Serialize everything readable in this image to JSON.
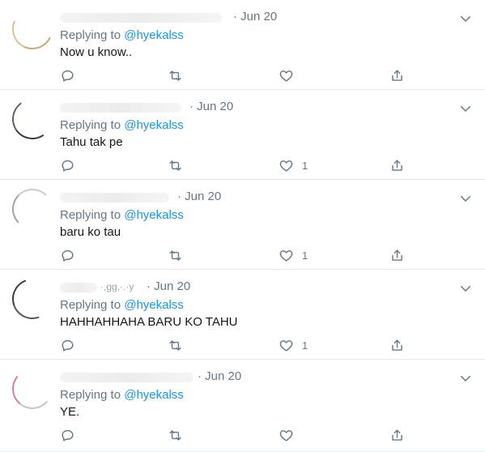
{
  "tweets": [
    {
      "date": "· Jun 20",
      "handle_tail": "",
      "replying_prefix": "Replying to ",
      "mention": "@hyekalss",
      "text": "Now u know..",
      "likes": ""
    },
    {
      "date": "· Jun 20",
      "handle_tail": "",
      "replying_prefix": "Replying to ",
      "mention": "@hyekalss",
      "text": "Tahu tak pe",
      "likes": "1"
    },
    {
      "date": "· Jun 20",
      "handle_tail": "",
      "replying_prefix": "Replying to ",
      "mention": "@hyekalss",
      "text": "baru ko tau",
      "likes": "1"
    },
    {
      "date": "· Jun 20",
      "handle_tail": "·,ɡɡ,·.·y",
      "replying_prefix": "Replying to ",
      "mention": "@hyekalss",
      "text": "HAHHAHHAHA BARU KO TAHU",
      "likes": "1"
    },
    {
      "date": "· Jun 20",
      "handle_tail": "",
      "replying_prefix": "Replying to ",
      "mention": "@hyekalss",
      "text": "YE.",
      "likes": ""
    }
  ],
  "icons": {
    "reply": "reply-icon",
    "retweet": "retweet-icon",
    "like": "heart-icon",
    "share": "share-icon",
    "more": "chevron-down-icon"
  },
  "colors": {
    "icon": "#657786",
    "mention": "#1b95e0",
    "divider": "#e6ecf0"
  }
}
